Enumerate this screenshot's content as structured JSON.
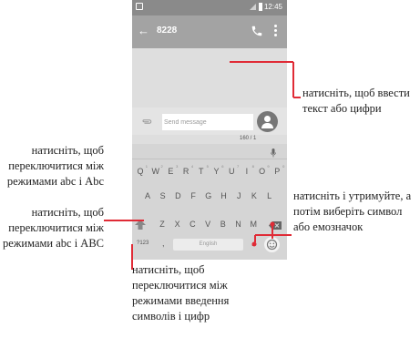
{
  "status_bar": {
    "time": "12:45"
  },
  "app_bar": {
    "title": "8228",
    "back_icon": "arrow-back-icon",
    "call_icon": "phone-icon",
    "menu_icon": "more-vert-icon"
  },
  "composer": {
    "placeholder": "Send message",
    "counter": "160 / 1",
    "attach_icon": "paperclip-icon",
    "send_icon": "avatar-icon"
  },
  "keyboard": {
    "row1": [
      "Q",
      "W",
      "E",
      "R",
      "T",
      "Y",
      "U",
      "I",
      "O",
      "P"
    ],
    "row1_numbers": [
      "1",
      "2",
      "3",
      "4",
      "5",
      "6",
      "7",
      "8",
      "9",
      "0"
    ],
    "row2": [
      "A",
      "S",
      "D",
      "F",
      "G",
      "H",
      "J",
      "K",
      "L"
    ],
    "row3": [
      "Z",
      "X",
      "C",
      "V",
      "B",
      "N",
      "M"
    ],
    "sym_label": "?123",
    "comma": ",",
    "space_label": "English",
    "period": "."
  },
  "callouts": {
    "input": "натисніть, щоб ввести текст або цифри",
    "case_toggle_1": "натисніть, щоб переключитися між режимами abc і Abc",
    "case_toggle_2": "натисніть, щоб переключитися між режимами abc і ABC",
    "symbols_emoji": "натисніть і утримуйте, а потім виберіть символ або емозначок",
    "symbols_numbers": "натисніть, щоб переключитися між режимами введення символів і цифр"
  },
  "colors": {
    "accent": "#e02b36",
    "appbar": "#a3a3a3",
    "statusbar": "#8a8a8a"
  }
}
